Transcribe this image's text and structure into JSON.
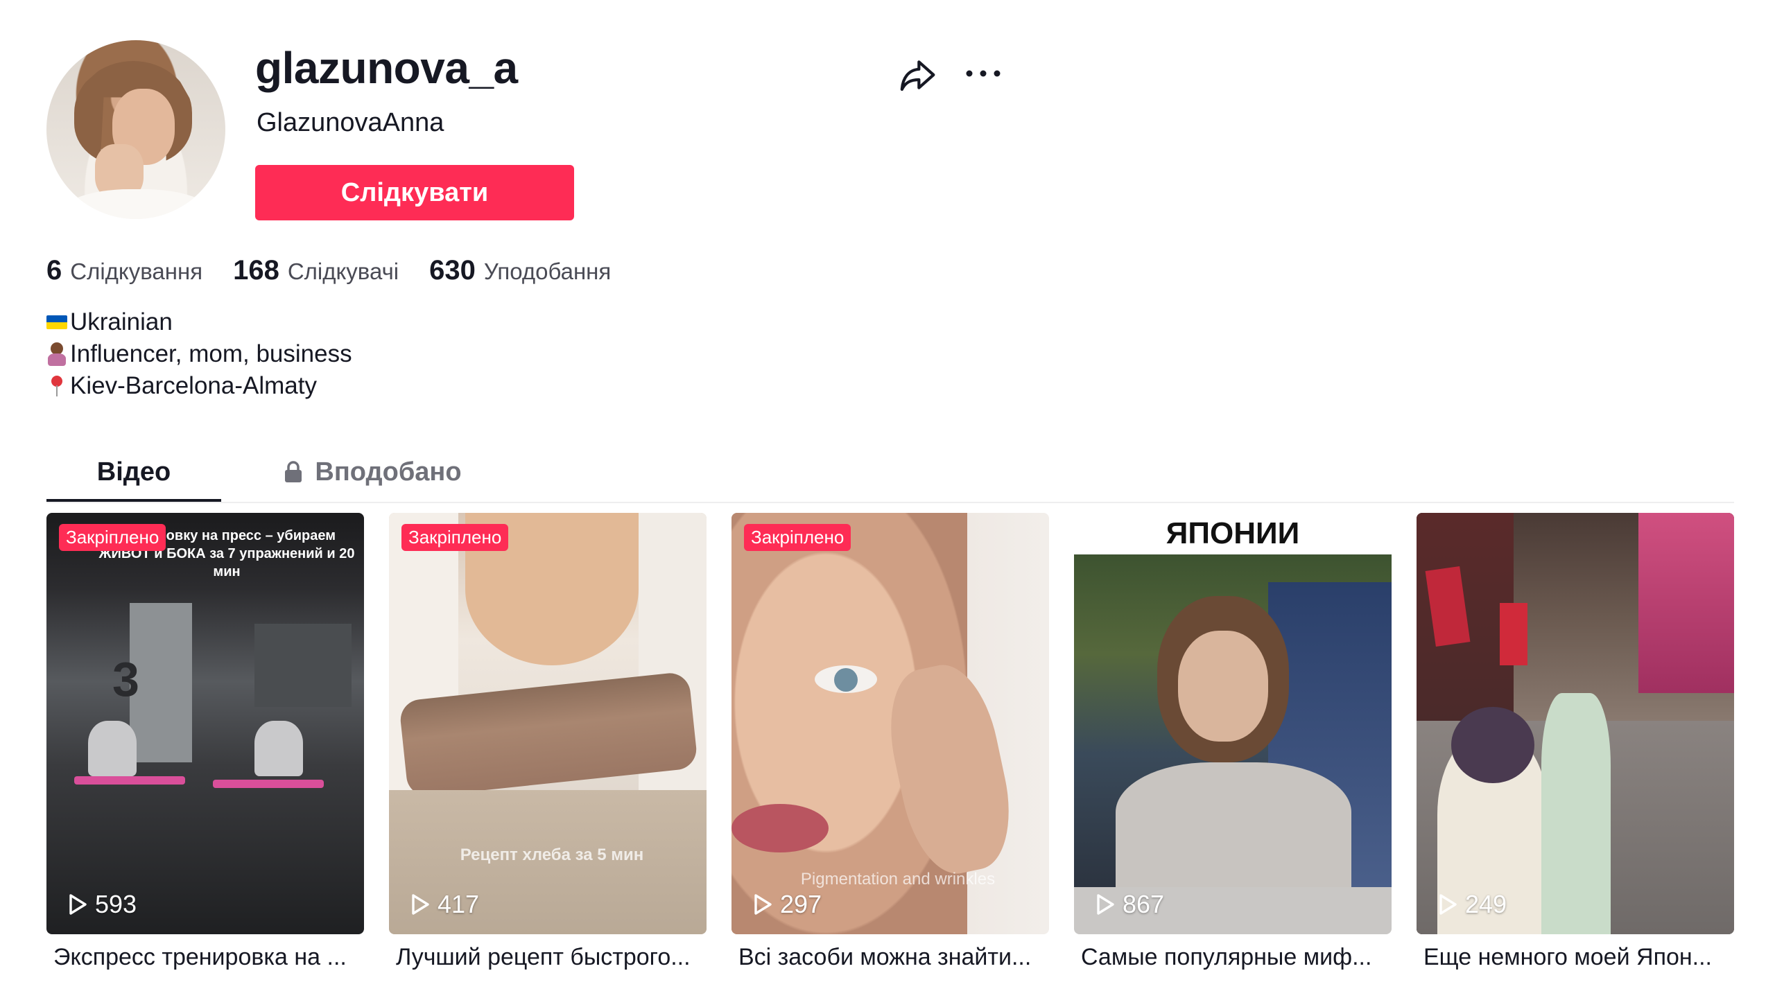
{
  "profile": {
    "username": "glazunova_a",
    "nickname": "GlazunovaAnna",
    "follow_label": "Слідкувати",
    "stats": [
      {
        "value": "6",
        "label": "Слідкування"
      },
      {
        "value": "168",
        "label": "Слідкувачі"
      },
      {
        "value": "630",
        "label": "Уподобання"
      }
    ],
    "bio": [
      "Ukrainian",
      "Influencer, mom, business",
      "Kiev-Barcelona-Almaty"
    ]
  },
  "icons": {
    "share": "share-icon",
    "more": "more-icon",
    "lock": "lock-icon",
    "play": "play-icon"
  },
  "tabs": [
    {
      "label": "Відео",
      "active": true
    },
    {
      "label": "Вподобано",
      "active": false
    }
  ],
  "videos": [
    {
      "pinned_label": "Закріплено",
      "views": "593",
      "caption": "Экспресс тренировка на ...",
      "overlay": "тренировку на пресс – убираем ЖИВОТ и БОКА за 7 упражнений и 20 мин"
    },
    {
      "pinned_label": "Закріплено",
      "views": "417",
      "caption": "Лучший рецепт быстрого...",
      "overlay": "Рецепт хлеба за 5 мин"
    },
    {
      "pinned_label": "Закріплено",
      "views": "297",
      "caption": "Всі засоби можна знайти...",
      "overlay": "Pigmentation and wrinkles"
    },
    {
      "pinned_label": "",
      "views": "867",
      "caption": "Самые популярные миф...",
      "overlay": "ЯПОНИИ"
    },
    {
      "pinned_label": "",
      "views": "249",
      "caption": "Еще немного моей Япон...",
      "overlay": ""
    }
  ],
  "colors": {
    "accent": "#fe2c55",
    "text": "#161823",
    "muted": "#6f7079"
  }
}
